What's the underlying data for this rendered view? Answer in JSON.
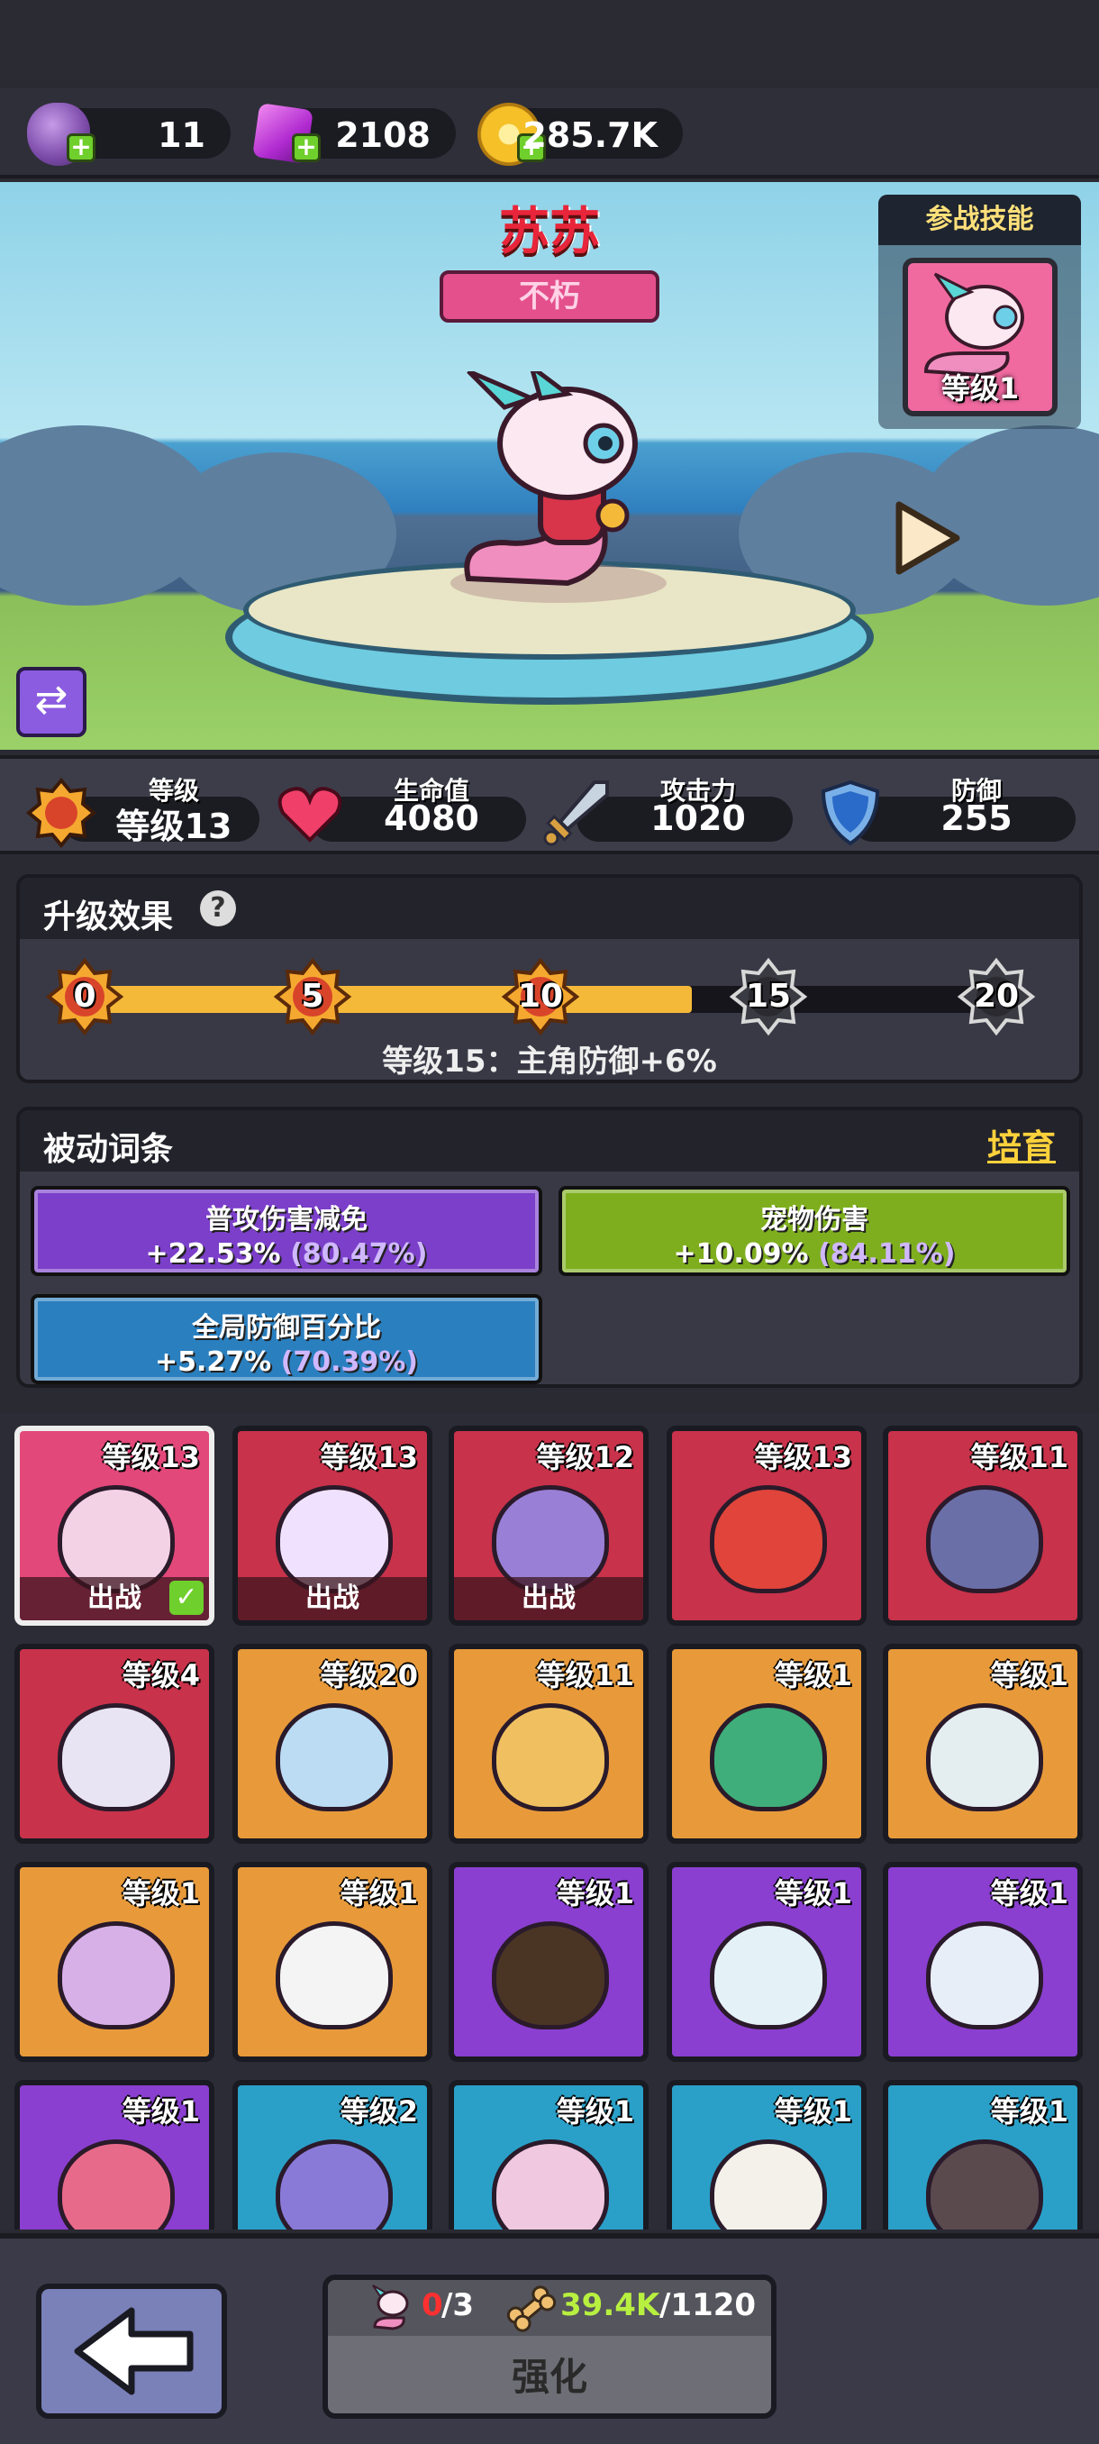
{
  "currencies": {
    "eggs": "11",
    "gems": "2108",
    "coins": "285.7K"
  },
  "hero": {
    "name": "苏苏",
    "rarity": "不朽"
  },
  "skill_panel": {
    "title": "参战技能",
    "level": "等级1"
  },
  "stats": [
    {
      "label": "等级",
      "value": "等级13"
    },
    {
      "label": "生命值",
      "value": "4080"
    },
    {
      "label": "攻击力",
      "value": "1020"
    },
    {
      "label": "防御",
      "value": "255"
    }
  ],
  "upgrade_effect": {
    "title": "升级效果",
    "milestones": [
      "0",
      "5",
      "10",
      "15",
      "20"
    ],
    "progress_fraction": 0.65,
    "current_effect": "等级15：主角防御+6%"
  },
  "passive": {
    "title": "被动词条",
    "train_label": "培育",
    "affixes": [
      {
        "name": "普攻伤害减免",
        "value": "+22.53%",
        "max": "(80.47%)",
        "color": "#7b3fc9"
      },
      {
        "name": "宠物伤害",
        "value": "+10.09%",
        "max": "(84.11%)",
        "color": "#7eae1e"
      },
      {
        "name": "全局防御百分比",
        "value": "+5.27%",
        "max": "(70.39%)",
        "color": "#2a7fbf"
      }
    ]
  },
  "pets": [
    {
      "level": "等级13",
      "battle": "出战",
      "bg": "#e2487a",
      "body": "#f4d2e6",
      "selected": true
    },
    {
      "level": "等级13",
      "battle": "出战",
      "bg": "#c8324a",
      "body": "#f0e2ff",
      "selected": false
    },
    {
      "level": "等级12",
      "battle": "出战",
      "bg": "#c8324a",
      "body": "#9a7fd6",
      "selected": false
    },
    {
      "level": "等级13",
      "battle": "",
      "bg": "#c8324a",
      "body": "#e0443a",
      "selected": false
    },
    {
      "level": "等级11",
      "battle": "",
      "bg": "#c8324a",
      "body": "#6b6fa8",
      "selected": false
    },
    {
      "level": "等级4",
      "battle": "",
      "bg": "#c8324a",
      "body": "#e8e4f4",
      "selected": false
    },
    {
      "level": "等级20",
      "battle": "",
      "bg": "#e89a3a",
      "body": "#bcdcf4",
      "selected": false
    },
    {
      "level": "等级11",
      "battle": "",
      "bg": "#e89a3a",
      "body": "#f0c060",
      "selected": false
    },
    {
      "level": "等级1",
      "battle": "",
      "bg": "#e89a3a",
      "body": "#3fae7a",
      "selected": false
    },
    {
      "level": "等级1",
      "battle": "",
      "bg": "#e89a3a",
      "body": "#e4eef0",
      "selected": false
    },
    {
      "level": "等级1",
      "battle": "",
      "bg": "#e89a3a",
      "body": "#d8b0e8",
      "selected": false
    },
    {
      "level": "等级1",
      "battle": "",
      "bg": "#e89a3a",
      "body": "#f4f4f4",
      "selected": false
    },
    {
      "level": "等级1",
      "battle": "",
      "bg": "#8a3fd0",
      "body": "#4a3424",
      "selected": false
    },
    {
      "level": "等级1",
      "battle": "",
      "bg": "#8a3fd0",
      "body": "#e4f2f8",
      "selected": false
    },
    {
      "level": "等级1",
      "battle": "",
      "bg": "#8a3fd0",
      "body": "#e8eef8",
      "selected": false
    },
    {
      "level": "等级1",
      "battle": "",
      "bg": "#8a3fd0",
      "body": "#e86a8a",
      "selected": false
    },
    {
      "level": "等级2",
      "battle": "",
      "bg": "#2aa0c8",
      "body": "#8a7ad8",
      "selected": false
    },
    {
      "level": "等级1",
      "battle": "",
      "bg": "#2aa0c8",
      "body": "#f0c8e0",
      "selected": false
    },
    {
      "level": "等级1",
      "battle": "",
      "bg": "#2aa0c8",
      "body": "#f4f0ea",
      "selected": false
    },
    {
      "level": "等级1",
      "battle": "",
      "bg": "#2aa0c8",
      "body": "#5a4a4e",
      "selected": false
    }
  ],
  "bottom": {
    "shards_have": "0",
    "shards_need": "/3",
    "bones_have": "39.4K",
    "bones_need": "/1120",
    "upgrade_label": "强化"
  }
}
